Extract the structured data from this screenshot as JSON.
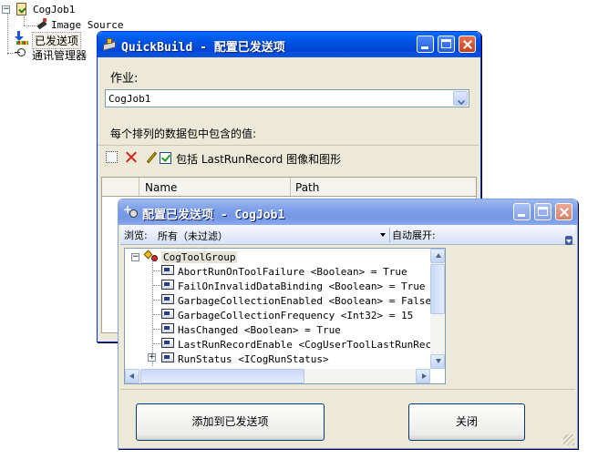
{
  "background_tree": {
    "items": [
      {
        "label": "CogJob1"
      },
      {
        "label": "Image Source"
      },
      {
        "label": "已发送项"
      },
      {
        "label": "通讯管理器"
      }
    ]
  },
  "quickbuild_window": {
    "title": "QuickBuild - 配置已发送项",
    "job_label": "作业:",
    "job_value": "CogJob1",
    "packet_label": "每个排列的数据包中包含的值:",
    "include_checkbox_label": "包括 LastRunRecord 图像和图形",
    "include_checked": true,
    "columns": [
      "Name",
      "Path"
    ]
  },
  "configure_window": {
    "title": "配置已发送项 - CogJob1",
    "browse_label": "浏览:",
    "browse_value": "所有（未过滤）",
    "auto_expand_label": "自动展开:",
    "tree_root": "CogToolGroup",
    "tree_items": [
      "AbortRunOnToolFailure <Boolean> = True",
      "FailOnInvalidDataBinding <Boolean> = True",
      "GarbageCollectionEnabled <Boolean> = False",
      "GarbageCollectionFrequency <Int32> = 15",
      "HasChanged <Boolean> = True",
      "LastRunRecordEnable <CogUserToolLastRunRecordC",
      "RunStatus <ICogRunStatus>"
    ],
    "add_button": "添加到已发送项",
    "close_button": "关闭"
  },
  "colors": {
    "xp_title": "#0054e3",
    "window_face": "#ece9d8",
    "close_red": "#d8542e",
    "delete_x": "#d0261c"
  }
}
